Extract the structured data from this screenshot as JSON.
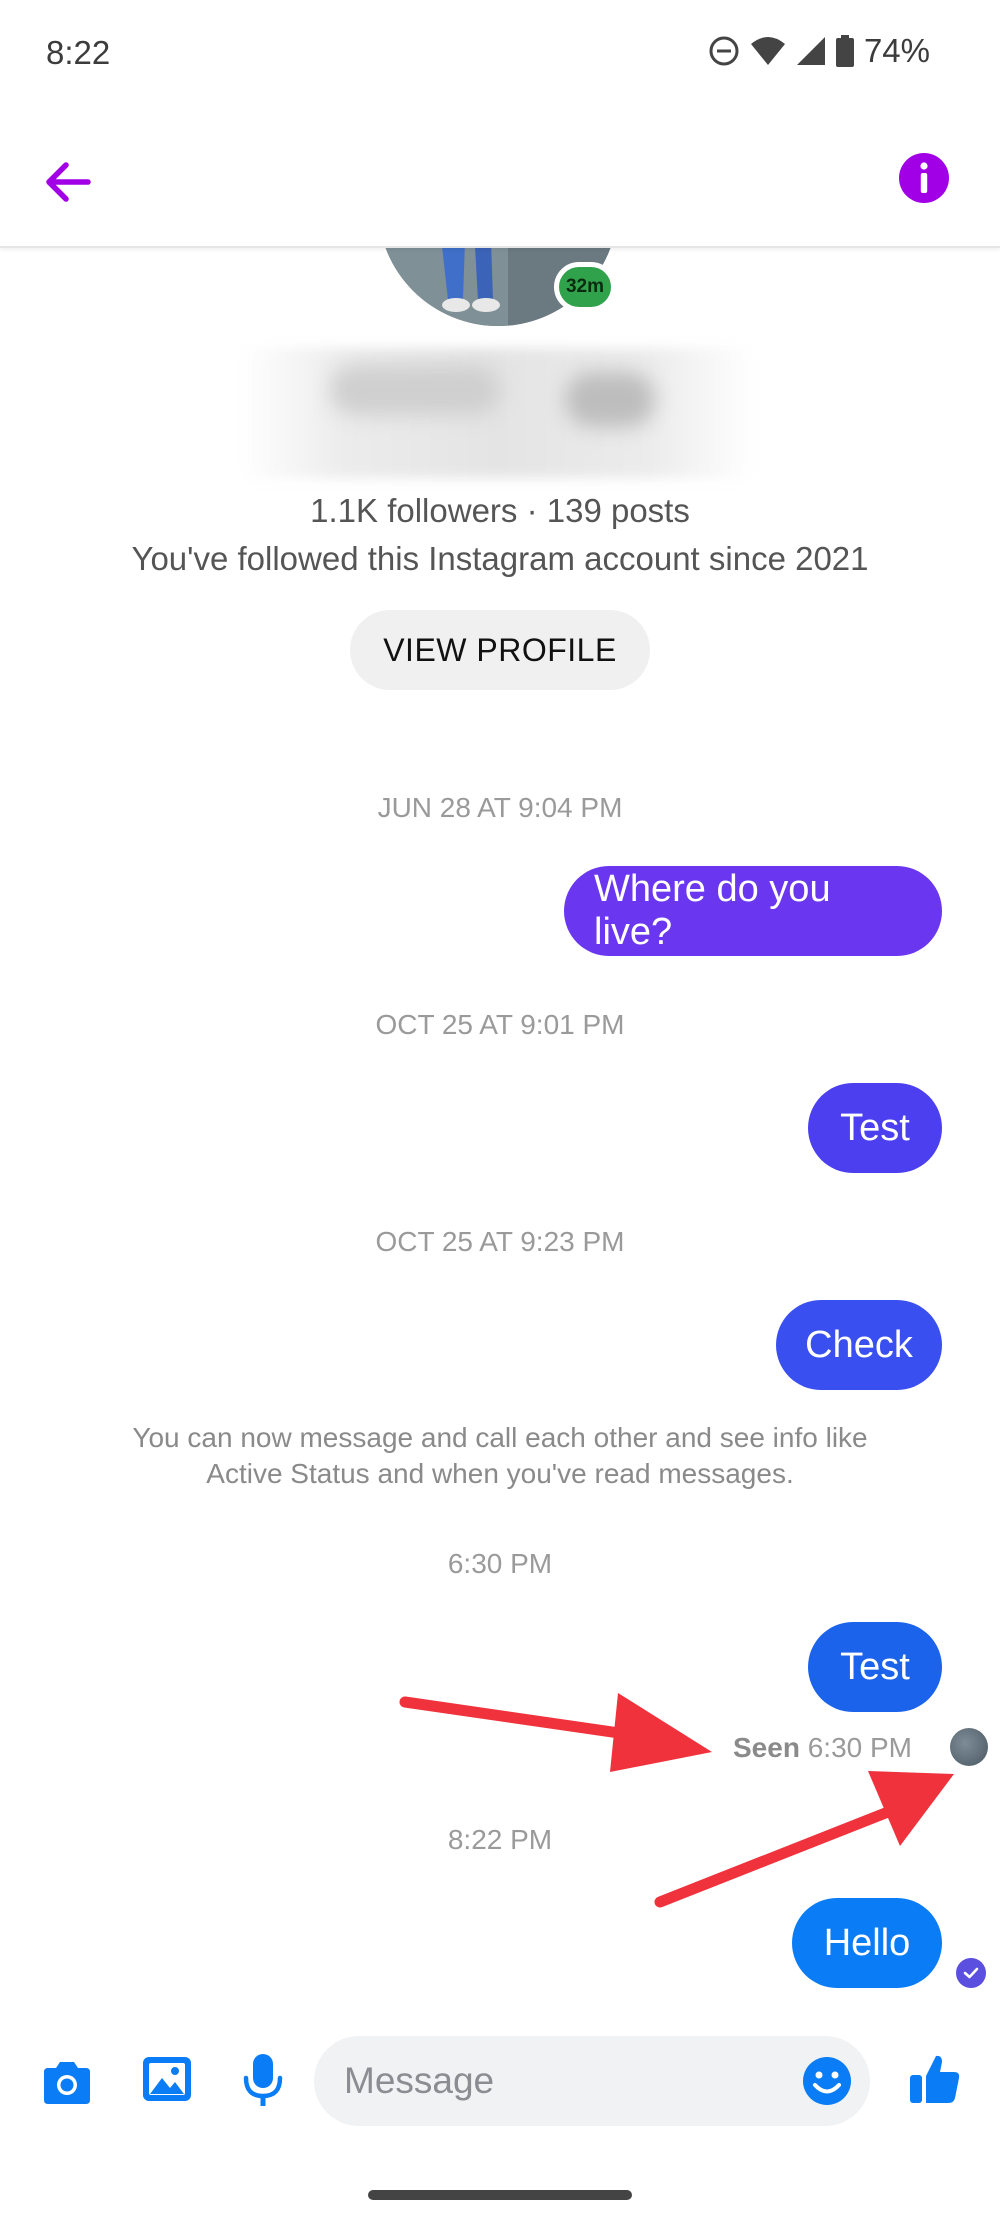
{
  "status_bar": {
    "time": "8:22",
    "battery": "74%"
  },
  "profile": {
    "active_badge": "32m",
    "followers": "1.1K followers · 139 posts",
    "follow_since": "You've followed this Instagram account since 2021",
    "view_profile_label": "VIEW PROFILE"
  },
  "messages": [
    {
      "timestamp": "JUN 28 AT 9:04 PM",
      "text": "Where do you live?",
      "color": "#6a36f0"
    },
    {
      "timestamp": "OCT 25 AT 9:01 PM",
      "text": "Test",
      "color": "#4b3ff0"
    },
    {
      "timestamp": "OCT 25 AT 9:23 PM",
      "text": "Check",
      "color": "#3a4ff0"
    },
    {
      "timestamp": "6:30 PM",
      "text": "Test",
      "color": "#1c63ec"
    },
    {
      "timestamp": "8:22 PM",
      "text": "Hello",
      "color": "#0a7cf5"
    }
  ],
  "info_notice": "You can now message and call each other and see info like Active Status and when you've read messages.",
  "seen": {
    "label": "Seen",
    "time": "6:30 PM"
  },
  "composer": {
    "placeholder": "Message"
  },
  "colors": {
    "accent_purple": "#a100e6",
    "icon_blue": "#0a7cf5",
    "arrow_red": "#f0323c"
  },
  "icons": [
    "back-arrow-icon",
    "info-icon",
    "camera-icon",
    "gallery-icon",
    "microphone-icon",
    "emoji-icon",
    "thumbs-up-icon"
  ]
}
